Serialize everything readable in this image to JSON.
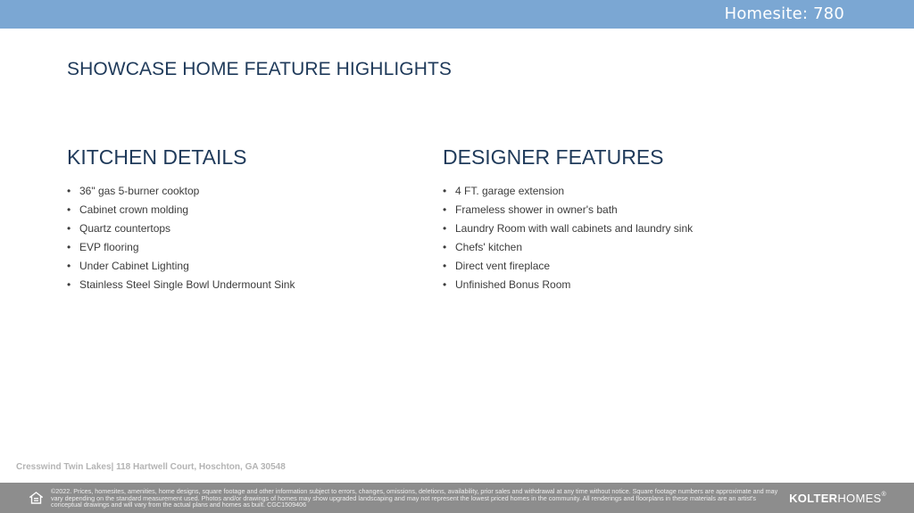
{
  "header": {
    "homesite": "Homesite: 780"
  },
  "page_title": "SHOWCASE HOME FEATURE HIGHLIGHTS",
  "kitchen": {
    "title": "KITCHEN DETAILS",
    "items": [
      "36\" gas 5-burner cooktop",
      "Cabinet crown molding",
      "Quartz countertops",
      "EVP flooring",
      "Under Cabinet Lighting",
      "Stainless Steel Single Bowl Undermount Sink"
    ]
  },
  "designer": {
    "title": "DESIGNER FEATURES",
    "items": [
      "4 FT. garage extension",
      "Frameless shower in owner's bath",
      "Laundry Room with wall cabinets and laundry sink",
      "Chefs' kitchen",
      "Direct vent fireplace",
      "Unfinished Bonus Room"
    ]
  },
  "address": "Cresswind Twin Lakes| 118 Hartwell Court,  Hoschton, GA 30548",
  "footer": {
    "disclaimer": "©2022. Prices, homesites, amenities, home designs, square footage and other information subject to errors, changes, omissions, deletions, availability, prior sales and withdrawal at any time without notice. Square footage numbers are approximate and may vary depending on the standard measurement used. Photos and/or drawings of homes may show upgraded landscaping and may not represent the lowest priced homes in the community. All renderings and floorplans in these materials are an artist's conceptual drawings and will vary from the actual plans and homes as built. CGC1509406",
    "brand_part1": "KOLTER",
    "brand_part2": "HOMES",
    "brand_reg": "®",
    "eho_icon": "equal-housing-opportunity-icon"
  },
  "colors": {
    "header_bar": "#7ba7d3",
    "heading": "#1f3a5a",
    "footer_bar": "#8d8d8d"
  }
}
